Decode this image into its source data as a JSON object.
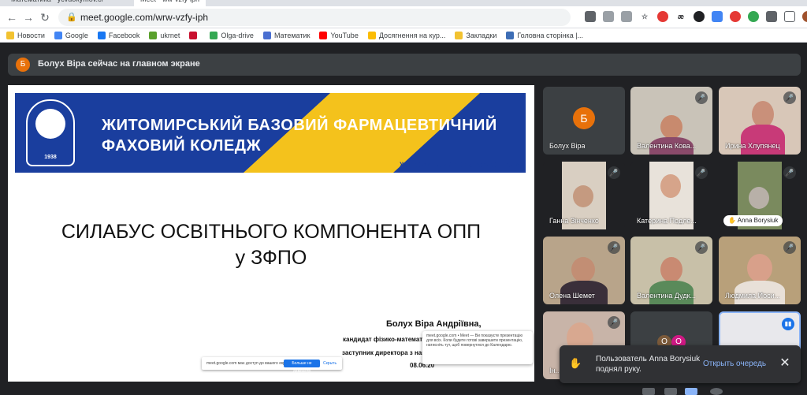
{
  "browser": {
    "tabs": [
      {
        "label": "Математика - ycvdokymov.ci"
      },
      {
        "label": "Meet - ww-vzfy-iph"
      }
    ],
    "url": "meet.google.com/wrw-vzfy-iph",
    "bookmarks": [
      {
        "label": "Новости",
        "color": "#f2c230"
      },
      {
        "label": "Google",
        "color": "#4285f4"
      },
      {
        "label": "Facebook",
        "color": "#1877f2"
      },
      {
        "label": "ukrnet",
        "color": "#5aa02c"
      },
      {
        "label": "",
        "color": "#c8102e"
      },
      {
        "label": "Olga-drive",
        "color": "#34a853"
      },
      {
        "label": "Математик",
        "color": "#4a6fd1"
      },
      {
        "label": "YouTube",
        "color": "#ff0000"
      },
      {
        "label": "Досягнення на кур...",
        "color": "#fbbc04"
      },
      {
        "label": "Закладки",
        "color": "#f2c230"
      },
      {
        "label": "Головна сторінка |...",
        "color": "#3d6db5"
      }
    ]
  },
  "meet": {
    "banner": {
      "avatar": "Б",
      "text": "Болух Віра сейчас на главном экране"
    },
    "slide": {
      "college_line1": "ЖИТОМИРСЬКИЙ БАЗОВИЙ ФАРМАЦЕВТИЧНИЙ",
      "college_line2": "ФАХОВИЙ КОЛЕДЖ",
      "college_line3": "ЖИТОМИРСЬКОЇ ОБЛАСНОЇ РАДИ",
      "logo_year": "1938",
      "title_line1": "СИЛАБУС ОСВІТНЬОГО КОМПОНЕНТА ОПП",
      "title_line2": "у ЗФПО",
      "author": "Болух Віра Андріївна,",
      "degree": "кандидат фізико-математичних",
      "position": "заступник директора з навча",
      "date": "08.06.20",
      "popup_text": "meet.google.com • Meet — Ви показуєте презентацію для всіх. Коли будете готові завершити презентацію, натисніть тут, щоб повернутися до Календарю.",
      "share_msg": "meet.google.com має доступ до вашого екрана.",
      "share_stop": "Больше не демонстр",
      "share_hide": "Скрыть"
    },
    "participants": [
      {
        "name": "Болух Віра",
        "avatar": "Б"
      },
      {
        "name": "Валентина Кова..."
      },
      {
        "name": "Ирина Хлупянец"
      },
      {
        "name": "Ганна Зінченко"
      },
      {
        "name": "Катерина Подле..."
      },
      {
        "name": "Anna Borysiuk"
      },
      {
        "name": "Олена Шемет"
      },
      {
        "name": "Валентина Дудк..."
      },
      {
        "name": "Людмила Йоси..."
      },
      {
        "name": "Ін..."
      },
      {
        "o1": "О",
        "o2": "О"
      },
      {
        "name": ""
      }
    ],
    "toast": {
      "message": "Пользователь Anna Borysiuk поднял руку.",
      "action": "Открыть очередь",
      "close": "✕"
    }
  }
}
